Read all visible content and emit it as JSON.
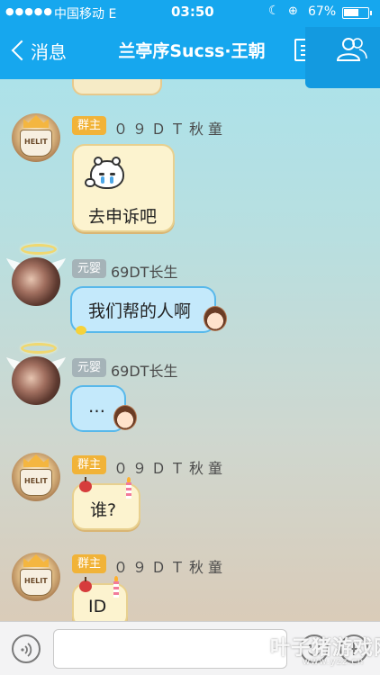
{
  "status_bar": {
    "signal_dots": "●●●●●",
    "carrier": "中国移动",
    "network": "E",
    "time": "03:50",
    "battery_percent": "67%",
    "battery_level": 0.67
  },
  "nav": {
    "back_label": "消息",
    "title": "兰亭序Sucss·王朝"
  },
  "messages": [
    {
      "role": "群主",
      "sender": "０９ＤＴ秋童",
      "text": "去申诉吧",
      "has_sticker": true
    },
    {
      "role": "元婴",
      "sender": "69DT长生",
      "text": "我们帮的人啊"
    },
    {
      "role": "元婴",
      "sender": "69DT长生",
      "text": "…"
    },
    {
      "role": "群主",
      "sender": "０９ＤＴ秋童",
      "text": "谁?"
    },
    {
      "role": "群主",
      "sender": "０９ＤＴ秋童",
      "text": "ID"
    }
  ],
  "owner_avatar_text": "HELIT",
  "input": {
    "placeholder": "",
    "value": ""
  },
  "watermark": {
    "main": "叶子猪游戏网",
    "sub": "www.yzz.cn"
  },
  "colors": {
    "nav_bg": "#16a7ee",
    "owner_badge": "#f1b338",
    "member_badge": "#a5b3b8",
    "bubble_yellow": "#fcf3cf",
    "bubble_blue": "#c4e9fb"
  },
  "icons": {
    "back": "chevron-left-icon",
    "menu": "menu-icon",
    "profile": "group-members-icon",
    "voice": "voice-icon",
    "emoji": "emoji-icon",
    "plus": "plus-icon"
  }
}
